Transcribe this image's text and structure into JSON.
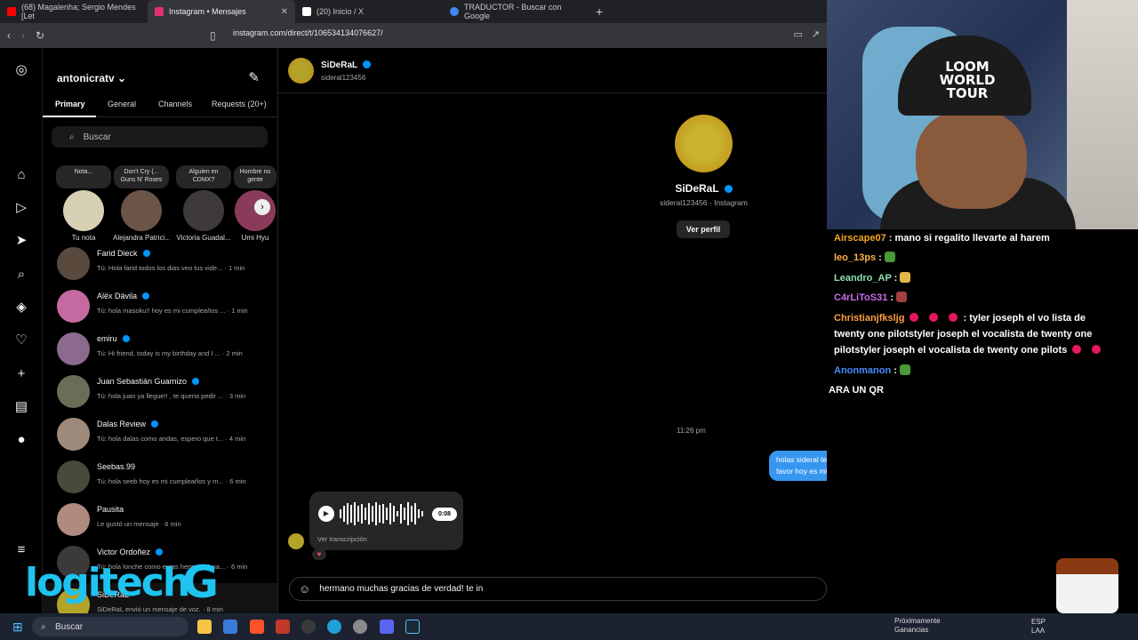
{
  "browser": {
    "tabs": [
      {
        "label": "(68) Magalenha; Sergio Mendes [Let",
        "color": "#ff0000"
      },
      {
        "label": "Instagram • Mensajes",
        "color": "#e1306c"
      },
      {
        "label": "(20) Inicio / X",
        "color": "#ffffff"
      },
      {
        "label": "TRADUCTOR - Buscar con Google",
        "color": "#4285f4"
      }
    ],
    "url": "instagram.com/direct/t/106534134076627/"
  },
  "inbox": {
    "username": "antonicratv",
    "tabs": [
      "Primary",
      "General",
      "Channels",
      "Requests (20+)"
    ],
    "search_placeholder": "Buscar",
    "notes": [
      {
        "bubble": "Nota...",
        "name": "Tu nota",
        "color": "#d7d0b4"
      },
      {
        "bubble": "Don't Cry (... Guns N' Roses",
        "name": "Alejandra Patrici...",
        "color": "#6b5448"
      },
      {
        "bubble": "Alguien en CDMX?",
        "name": "Victoria Guadal...",
        "color": "#3e3a3a"
      },
      {
        "bubble": "Hombre no gente",
        "name": "Umi Hyu",
        "color": "#8a3b5a"
      }
    ],
    "threads": [
      {
        "name": "Farid Dieck",
        "verified": true,
        "msg": "Tú: Hola farid todos los dias veo tus vide...",
        "time": "· 1 min",
        "color": "#5a4a3e"
      },
      {
        "name": "Alëx Dávila",
        "verified": true,
        "msg": "Tú: hola masoku!! hoy es mi cumpleaños ...",
        "time": "· 1 min",
        "color": "#c46aa0"
      },
      {
        "name": "emiru",
        "verified": true,
        "msg": "Tú: Hi friend, today is my birthday and I ...",
        "time": "· 2 min",
        "color": "#8c6a8e"
      },
      {
        "name": "Juan Sebastián Guarnizo",
        "verified": true,
        "msg": "Tú: hola juan ya llegue!! , te queria pedir ...",
        "time": "· 3 min",
        "color": "#6a6d58"
      },
      {
        "name": "Dalas Review",
        "verified": true,
        "msg": "Tú: hola dalas como andas, espero que t...",
        "time": "· 4 min",
        "color": "#9d8a7a"
      },
      {
        "name": "Seebas.99",
        "verified": false,
        "msg": "Tú: hola seeb hoy es mi cumpleaños y m...",
        "time": "· 6 min",
        "color": "#4a4a3a"
      },
      {
        "name": "Pausita",
        "verified": false,
        "msg": "Le gustó un mensaje · 6 min",
        "time": "",
        "color": "#b08a7e"
      },
      {
        "name": "Victor Ordoñez",
        "verified": true,
        "msg": "Tú: hola lonche como estas hermano? pa...",
        "time": "· 6 min",
        "color": "#3a3a3a"
      },
      {
        "name": "SiDeRaL",
        "verified": false,
        "msg": "SiDeRaL envió un mensaje de voz.",
        "time": "· 8 min",
        "color": "#b4a329"
      }
    ]
  },
  "chat": {
    "name": "SiDeRaL",
    "username": "sideral123456",
    "profile_sub": "sideral123456 · Instagram",
    "profile_button": "Ver perfil",
    "timestamp": "11:26 pm",
    "sent_message": "holas sideral te sigo desde que te reias de el tren de aragua me gustaria pedirte un saludito por favor hoy es mi cumple",
    "voice_duration": "0:08",
    "voice_transcription": "Ver transcripción",
    "composer_text": "hermano muchas gracias de verdad! te in"
  },
  "stream_chat": [
    {
      "user": "Airscape07",
      "color": "#f5a623",
      "text": ": mano si regalito llevarte al harem"
    },
    {
      "user": "leo_13ps",
      "color": "#ffb347",
      "text": ":"
    },
    {
      "user": "Leandro_AP",
      "color": "#8de0b0",
      "text": ":"
    },
    {
      "user": "C4rLiToS31",
      "color": "#c76cf0",
      "text": ":"
    },
    {
      "user": "Christianjfksljg",
      "color": "#ff9f40",
      "text": ": tyler joseph el vo lista de"
    },
    {
      "user": "",
      "color": "#ffffff",
      "text": "twenty one pilotstyler joseph el vocalista de twenty one"
    },
    {
      "user": "",
      "color": "#ffffff",
      "text": "pilotstyler joseph el vocalista de twenty one pilots"
    },
    {
      "user": "Anonmanon",
      "color": "#4a8dff",
      "text": ":"
    },
    {
      "user": "",
      "color": "#ffffff",
      "text": "ARA UN QR"
    }
  ],
  "stream": {
    "cap_text": "LOOM WORLD TOUR"
  },
  "taskbar": {
    "search": "Buscar",
    "news_title": "Próximamente",
    "news_sub": "Ganancias",
    "lang": "ESP",
    "lang_sub": "LAA"
  },
  "overlay": {
    "brand": "logitech",
    "brand_g": "G"
  }
}
